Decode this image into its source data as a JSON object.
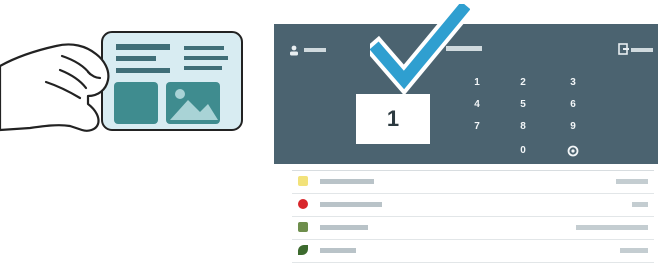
{
  "entry": {
    "value": "1"
  },
  "keypad": {
    "keys": [
      "1",
      "2",
      "3",
      "4",
      "5",
      "6",
      "7",
      "8",
      "9",
      "0"
    ]
  },
  "list": {
    "items": [
      {
        "icon": "folder-icon",
        "color": "#f2e27a"
      },
      {
        "icon": "apple-icon",
        "color": "#d8262b"
      },
      {
        "icon": "box-icon",
        "color": "#6e8e4c"
      },
      {
        "icon": "leaf-icon",
        "color": "#3c6a2e"
      }
    ]
  },
  "colors": {
    "terminal": "#4b6370",
    "checkmark": "#2f9fd0",
    "card": "#d8ecf2",
    "card_accent": "#3f8c8f"
  }
}
